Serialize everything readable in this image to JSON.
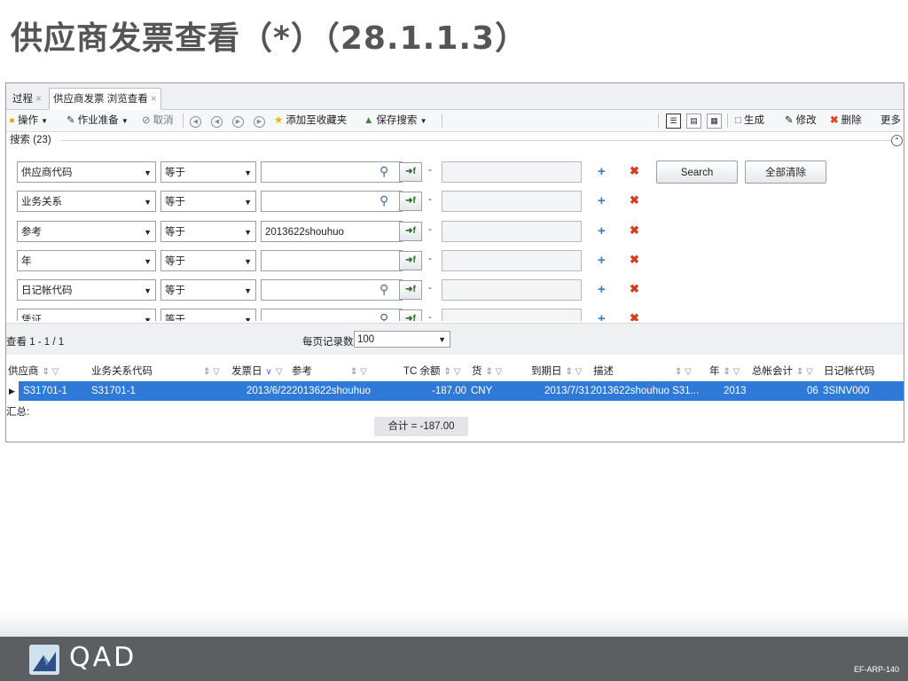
{
  "slide": {
    "title": "供应商发票查看（*）（28.1.1.3）",
    "logo_text": "QAD",
    "code": "EF-ARP-140"
  },
  "tabs": [
    {
      "label": "过程",
      "close": "×"
    },
    {
      "label": "供应商发票 浏览查看",
      "close": "×"
    }
  ],
  "toolbar": {
    "actions": "操作",
    "prep": "作业准备",
    "cancel": "取消",
    "favorites": "添加至收藏夹",
    "save_search": "保存搜索",
    "generate": "生成",
    "modify": "修改",
    "delete": "删除",
    "more": "更多"
  },
  "search": {
    "header": "搜索 (23)",
    "search_button": "Search",
    "clear_button": "全部清除",
    "rows": [
      {
        "field": "供应商代码",
        "op": "等于",
        "value": "",
        "magnifier": true
      },
      {
        "field": "业务关系",
        "op": "等于",
        "value": "",
        "magnifier": true
      },
      {
        "field": "参考",
        "op": "等于",
        "value": "2013622shouhuo",
        "magnifier": false
      },
      {
        "field": "年",
        "op": "等于",
        "value": "",
        "magnifier": false
      },
      {
        "field": "日记帐代码",
        "op": "等于",
        "value": "",
        "magnifier": true
      },
      {
        "field": "凭证",
        "op": "等于",
        "value": "",
        "magnifier": true
      }
    ]
  },
  "paging": {
    "view_label": "查看 1 - 1 / 1",
    "per_page_label": "每页记录数:",
    "per_page_value": "100"
  },
  "grid": {
    "columns": [
      "供应商",
      "业务关系代码",
      "发票日",
      "参考",
      "TC 余额",
      "货",
      "到期日",
      "描述",
      "年",
      "总帐会计",
      "日记帐代码"
    ],
    "row": {
      "supplier": "S31701-1",
      "business_relation": "S31701-1",
      "invoice_date": "2013/6/22",
      "reference": "2013622shouhuo",
      "tc_balance": "-187.00",
      "currency": "CNY",
      "due_date": "2013/7/31",
      "description": "2013622shouhuo S31...",
      "year": "2013",
      "gl_period": "06",
      "journal_code": "3SINV000"
    },
    "summary_label": "汇总:",
    "total": "合计 = -187.00"
  }
}
